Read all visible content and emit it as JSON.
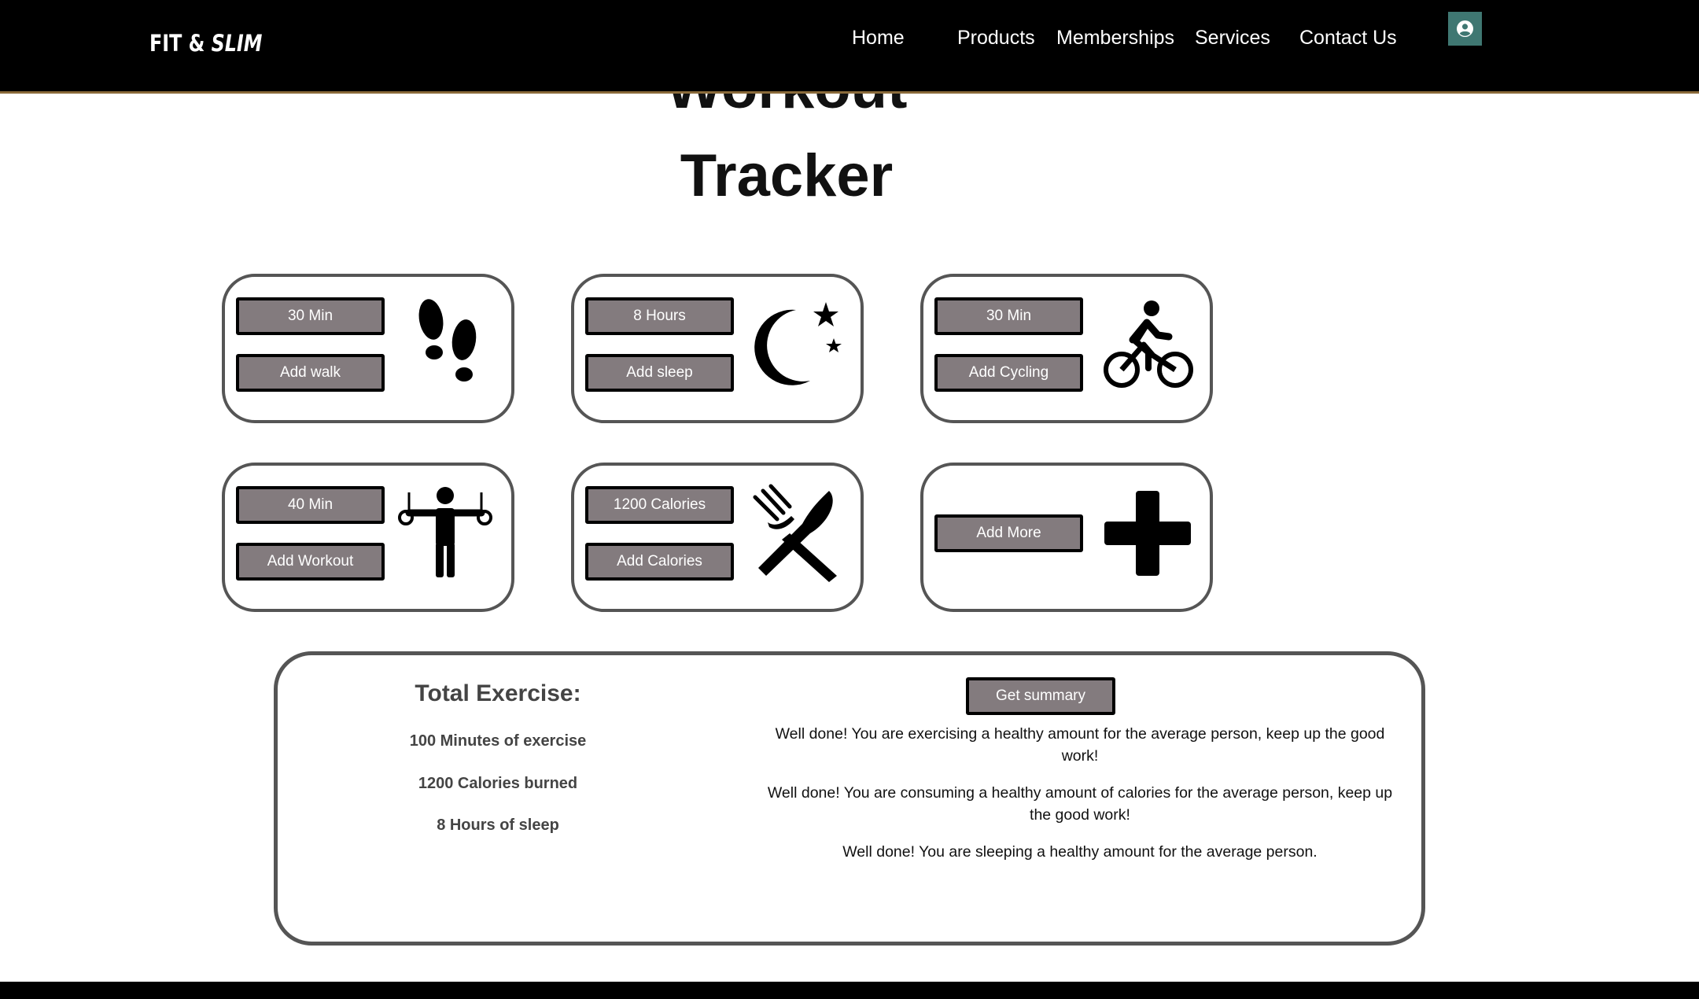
{
  "header": {
    "logo_main": "FIT &",
    "logo_accent": "SLIM",
    "nav": {
      "home": "Home",
      "products": "Products",
      "memberships": "Memberships",
      "services": "Services",
      "contact": "Contact Us"
    },
    "user_icon": "user-circle-icon"
  },
  "page": {
    "title_line1": "Workout",
    "title_line2": "Tracker"
  },
  "cards": {
    "walk": {
      "value": "30 Min",
      "action": "Add walk",
      "icon": "footsteps-icon"
    },
    "sleep": {
      "value": "8 Hours",
      "action": "Add sleep",
      "icon": "moon-stars-icon"
    },
    "cycling": {
      "value": "30 Min",
      "action": "Add Cycling",
      "icon": "cyclist-icon"
    },
    "workout": {
      "value": "40 Min",
      "action": "Add Workout",
      "icon": "gymnast-rings-icon"
    },
    "calories": {
      "value": "1200 Calories",
      "action": "Add Calories",
      "icon": "fork-knife-icon"
    },
    "more": {
      "action": "Add More",
      "icon": "plus-icon"
    }
  },
  "summary": {
    "heading": "Total Exercise:",
    "stats": {
      "minutes": "100 Minutes of exercise",
      "calories": "1200 Calories burned",
      "sleep": "8 Hours of sleep"
    },
    "button": "Get summary",
    "messages": {
      "exercise": "Well done! You are exercising a healthy amount for the average person, keep up the good work!",
      "calories": "Well done! You are consuming a healthy amount of calories for the average person, keep up the good work!",
      "sleep": "Well done! You are sleeping a healthy amount for the average person."
    }
  },
  "colors": {
    "header_bg": "#000000",
    "button_bg": "#837b7e",
    "card_border": "#555555",
    "user_button": "#3f7772"
  }
}
